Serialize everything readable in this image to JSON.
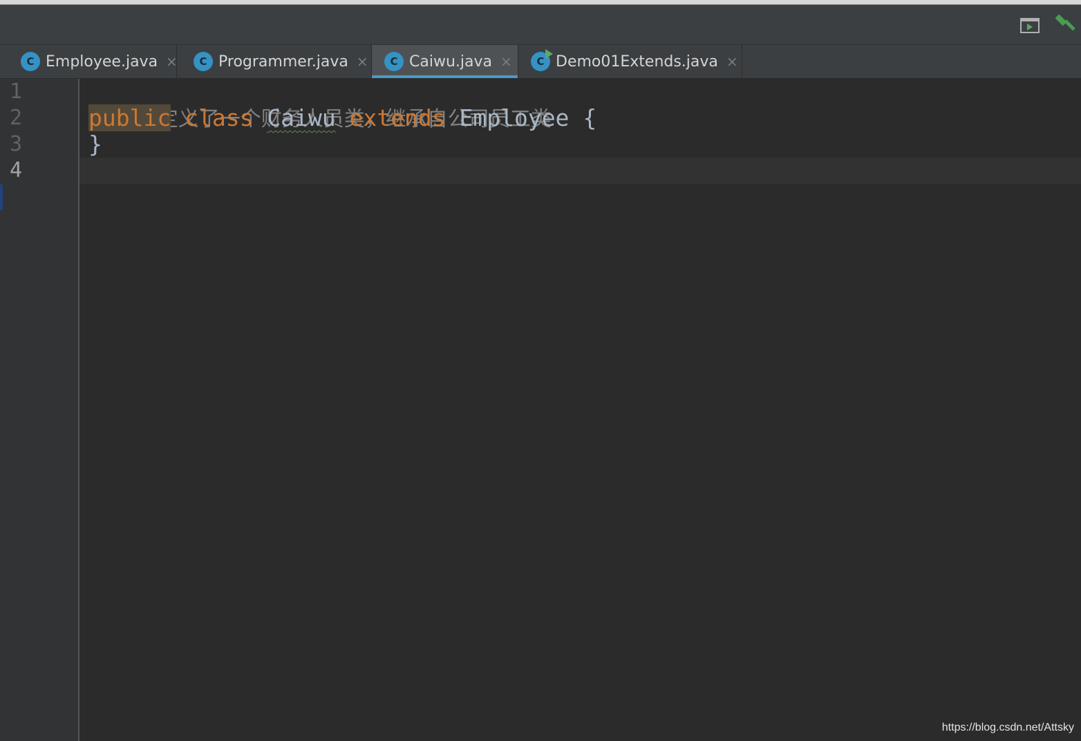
{
  "toolbar": {
    "run_icon": "run-window-icon",
    "build_icon": "build-hammer-icon"
  },
  "tabs": [
    {
      "label": "Employee.java",
      "icon": "class-icon",
      "icon_letter": "C",
      "active": false
    },
    {
      "label": "Programmer.java",
      "icon": "class-icon",
      "icon_letter": "C",
      "active": false
    },
    {
      "label": "Caiwu.java",
      "icon": "class-icon",
      "icon_letter": "C",
      "active": true
    },
    {
      "label": "Demo01Extends.java",
      "icon": "runnable-class-icon",
      "icon_letter": "C",
      "active": false
    }
  ],
  "close_glyph": "×",
  "gutter": {
    "line_numbers": [
      "1",
      "2",
      "3",
      "4"
    ],
    "current_line": "4"
  },
  "code": {
    "line1_comment": "//定义了一个财务人员类，继承自公司员工类",
    "line2": {
      "kw_public": "public",
      "kw_class": "class",
      "class_name": "Caiwu",
      "kw_extends": "extends",
      "super_name": "Employee",
      "open_brace": "{"
    },
    "line3_close": "}"
  },
  "watermark": "https://blog.csdn.net/Attsky",
  "colors": {
    "background": "#2b2b2b",
    "keyword": "#cc7832",
    "comment": "#808080",
    "text": "#a9b7c6",
    "class_icon": "#3592c4",
    "run_green": "#59a869"
  }
}
